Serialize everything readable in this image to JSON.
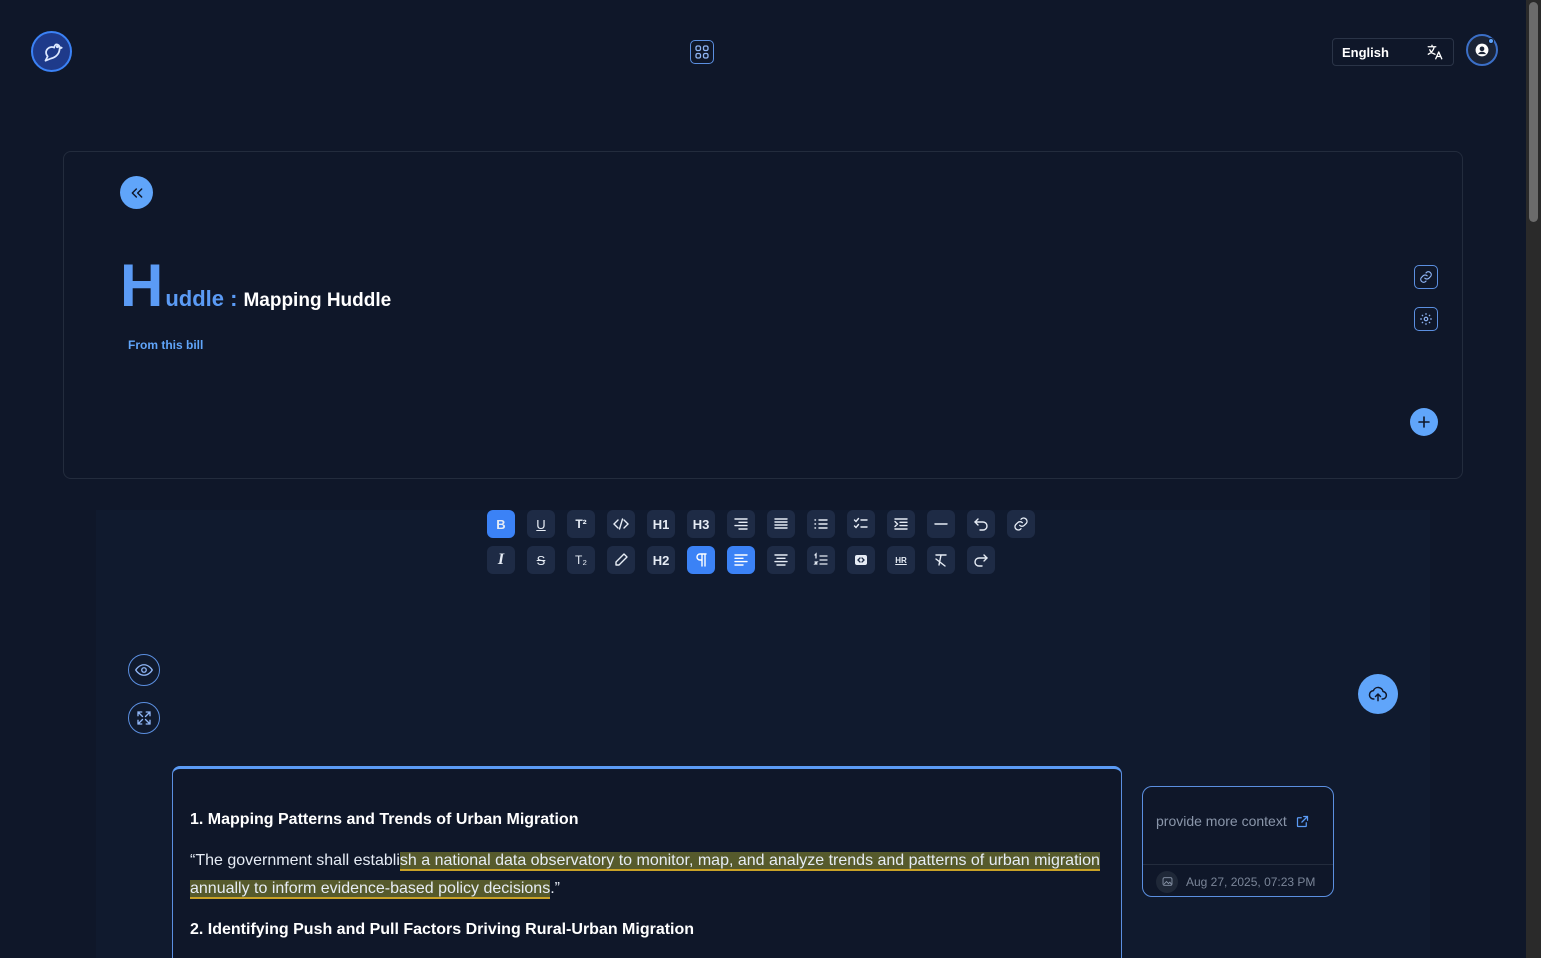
{
  "header": {
    "logo_icon": "bird-logo-icon",
    "apps_icon": "apps-grid-icon",
    "language": "English",
    "translate_icon": "translate-icon",
    "avatar_icon": "user-avatar-icon"
  },
  "card": {
    "back_icon": "double-chevron-left-icon",
    "title_big": "H",
    "title_rest": "uddle :",
    "subtitle": "Mapping Huddle",
    "from_label": "From this bill",
    "link_icon": "link-icon",
    "settings_icon": "gear-icon",
    "add_icon": "plus-icon"
  },
  "toolbar": {
    "row1": [
      "bold",
      "underline",
      "superscript",
      "code",
      "heading-1",
      "heading-3",
      "align-right",
      "justify",
      "bullet-list",
      "task-list",
      "indent",
      "horizontal-rule",
      "undo",
      "link"
    ],
    "row2": [
      "italic",
      "strikethrough",
      "subscript",
      "highlight",
      "heading-2",
      "paragraph",
      "align-left",
      "align-center",
      "ordered-list",
      "code-block",
      "hr",
      "clear-format",
      "redo"
    ],
    "labels": {
      "bold": "B",
      "underline": "U",
      "superscript": "T²",
      "heading-1": "H1",
      "heading-3": "H3",
      "italic": "I",
      "strikethrough": "S",
      "subscript": "T₂",
      "heading-2": "H2",
      "hr": "HR"
    },
    "active": [
      "bold",
      "paragraph",
      "align-left"
    ]
  },
  "side_controls": {
    "preview_icon": "eye-icon",
    "fullscreen_icon": "expand-icon",
    "upload_icon": "cloud-upload-icon"
  },
  "document": {
    "heading1": "1. Mapping Patterns and Trends of Urban Migration",
    "quote_before": " “The government shall establi",
    "quote_highlight": "sh a national data observatory to monitor, map, and analyze trends and patterns of urban migration annually to inform evidence-based policy decisions",
    "quote_after": ".”",
    "heading2": "2. Identifying Push and Pull Factors Driving Rural-Urban Migration"
  },
  "comment": {
    "text": "provide more context",
    "edit_icon": "external-edit-icon",
    "thumb_icon": "image-icon",
    "timestamp": "Aug 27, 2025, 07:23 PM"
  },
  "colors": {
    "background": "#0f1729",
    "accent": "#60a5fa",
    "active_button": "#3b82f6",
    "highlight": "#565a2c"
  }
}
